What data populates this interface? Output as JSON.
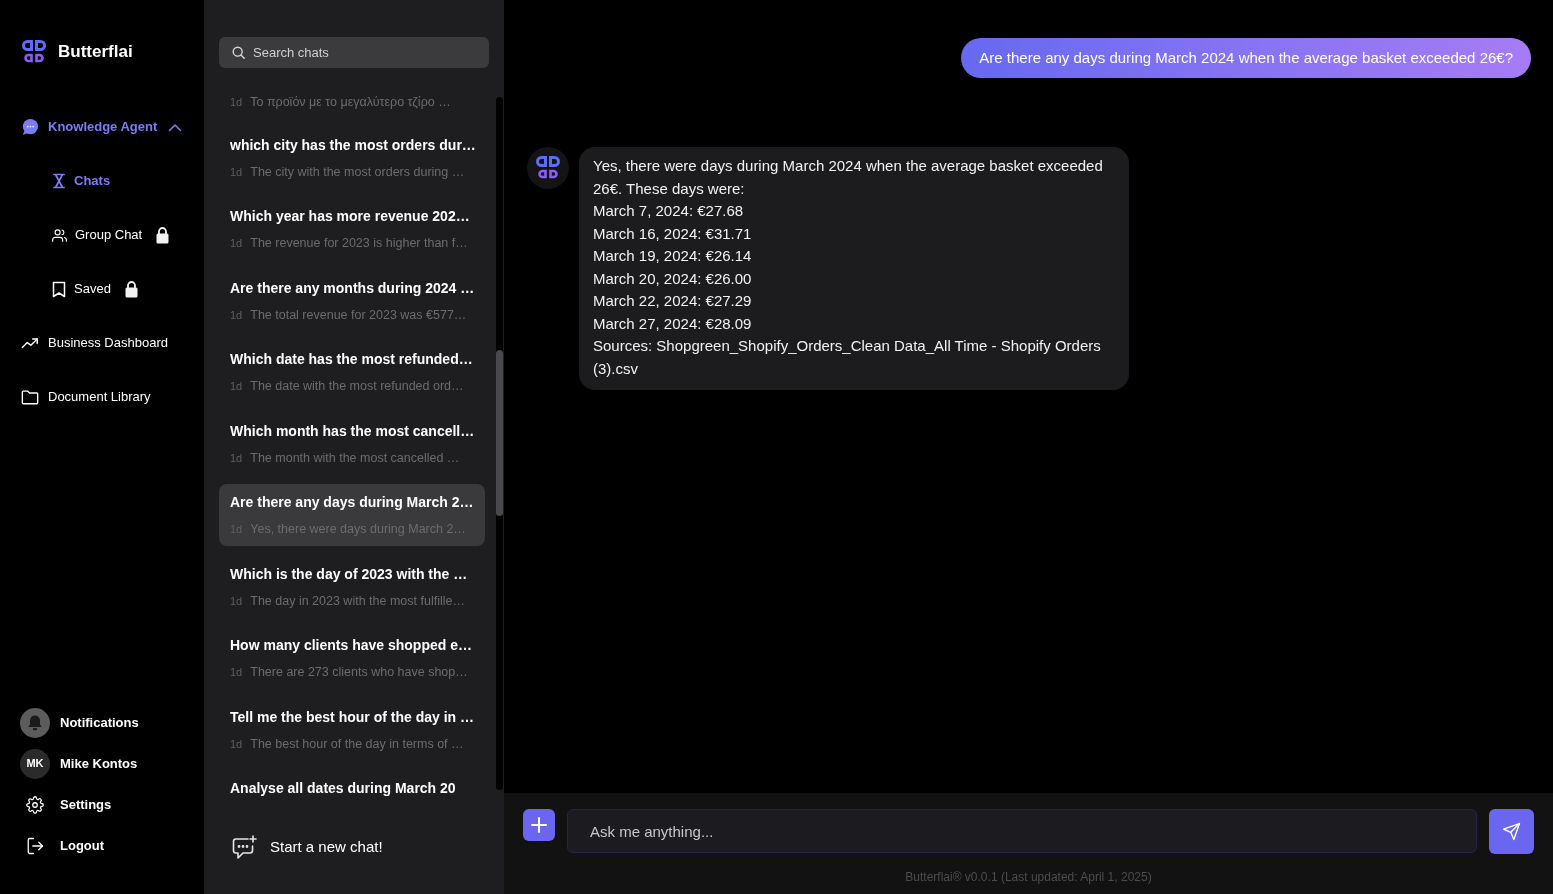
{
  "sidebar": {
    "brand": "Butterflai",
    "nav": [
      {
        "label": "Knowledge Agent",
        "selected": true,
        "expanded": true,
        "children": [
          {
            "label": "Chats",
            "selected": true,
            "locked": false
          },
          {
            "label": "Group Chat",
            "selected": false,
            "locked": true
          },
          {
            "label": "Saved",
            "selected": false,
            "locked": true
          }
        ]
      },
      {
        "label": "Business Dashboard",
        "selected": false
      },
      {
        "label": "Document Library",
        "selected": false
      }
    ],
    "account": [
      {
        "label": "Notifications"
      },
      {
        "label": "Mike Kontos",
        "initials": "MK"
      },
      {
        "label": "Settings"
      },
      {
        "label": "Logout"
      }
    ]
  },
  "chat_list": {
    "search": {
      "placeholder": "Search chats"
    },
    "items": [
      {
        "age": "1d",
        "preview": "Το προϊόν με το μεγαλύτερο τζίρο …",
        "selected": false
      },
      {
        "title": "which city has the most orders dur…",
        "age": "1d",
        "preview": "The city with the most orders during …",
        "selected": false
      },
      {
        "title": "Which year has more revenue 202…",
        "age": "1d",
        "preview": "The revenue for 2023 is higher than f…",
        "selected": false
      },
      {
        "title": "Are there any months during 2024 …",
        "age": "1d",
        "preview": "The total revenue for 2023 was €577…",
        "selected": false
      },
      {
        "title": "Which date has the most refunded…",
        "age": "1d",
        "preview": "The date with the most refunded ord…",
        "selected": false
      },
      {
        "title": "Which month has the most cancell…",
        "age": "1d",
        "preview": "The month with the most cancelled …",
        "selected": false
      },
      {
        "title": "Are there any days during March 2…",
        "age": "1d",
        "preview": "Yes, there were days during March 2…",
        "selected": true
      },
      {
        "title": "Which is the day of 2023 with the …",
        "age": "1d",
        "preview": "The day in 2023 with the most fulfille…",
        "selected": false
      },
      {
        "title": "How many clients have shopped e…",
        "age": "1d",
        "preview": "There are 273 clients who have shop…",
        "selected": false
      },
      {
        "title": "Tell me the best hour of the day in …",
        "age": "1d",
        "preview": "The best hour of the day in terms of …",
        "selected": false
      },
      {
        "title": "Analyse all dates during March 20",
        "selected": false
      }
    ],
    "new_chat": "Start a new chat!"
  },
  "conversation": {
    "messages": [
      {
        "kind": "user",
        "text": "Are there any days during March 2024 when the average basket exceeded 26€?"
      },
      {
        "kind": "assistant",
        "lines": [
          "Yes, there were days during March 2024 when the average basket exceeded 26€. These days were:",
          "March 7, 2024: €27.68",
          "March 16, 2024: €31.71",
          "March 19, 2024: €26.14",
          "March 20, 2024: €26.00",
          "March 22, 2024: €27.29",
          "March 27, 2024: €28.09",
          "Sources: Shopgreen_Shopify_Orders_Clean Data_All Time - Shopify Orders (3).csv"
        ]
      }
    ]
  },
  "composer": {
    "placeholder": "Ask me anything..."
  },
  "footer": "Butterflai® v0.0.1 (Last updated: April 1, 2025)"
}
